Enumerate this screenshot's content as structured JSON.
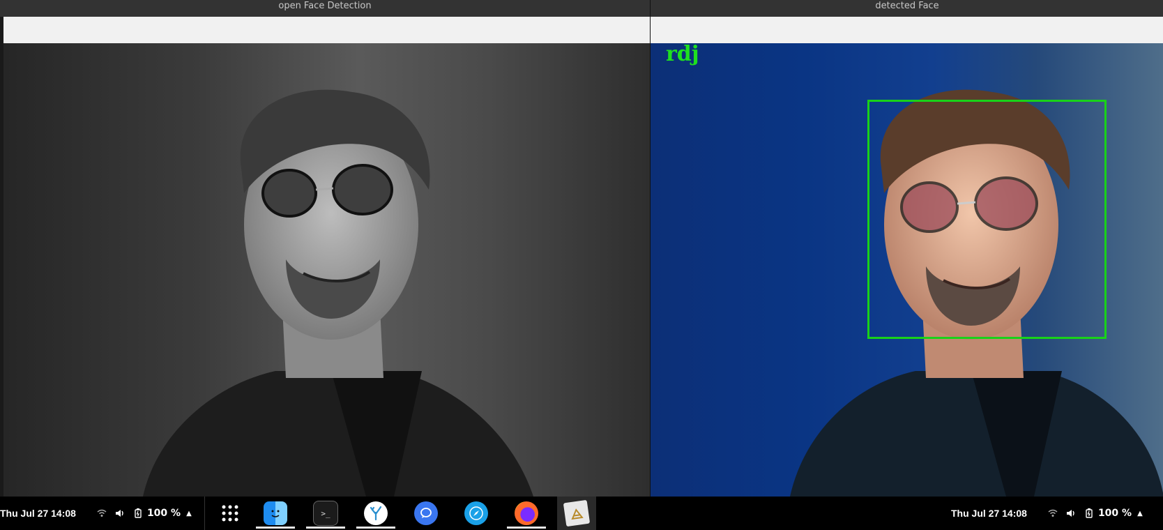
{
  "windows": {
    "left": {
      "title": "open Face Detection"
    },
    "right": {
      "title": "detected Face",
      "face_label": "rdj"
    }
  },
  "taskbar": {
    "left_tray": {
      "clock": "Thu Jul 27  14:08",
      "battery": "100 %"
    },
    "right_tray": {
      "clock": "Thu Jul 27  14:08",
      "battery": "100 %"
    },
    "apps": [
      {
        "name": "app-grid",
        "icon": "grid-icon"
      },
      {
        "name": "finder",
        "icon": "finder-icon",
        "running": true
      },
      {
        "name": "terminal",
        "icon": "terminal-icon",
        "running": true
      },
      {
        "name": "coral",
        "icon": "coral-icon",
        "running": true
      },
      {
        "name": "signal",
        "icon": "chat-icon"
      },
      {
        "name": "browser",
        "icon": "compass-icon"
      },
      {
        "name": "firefox",
        "icon": "firefox-icon",
        "running": true
      },
      {
        "name": "image-viewer",
        "icon": "image-viewer-icon",
        "active": true
      }
    ]
  }
}
